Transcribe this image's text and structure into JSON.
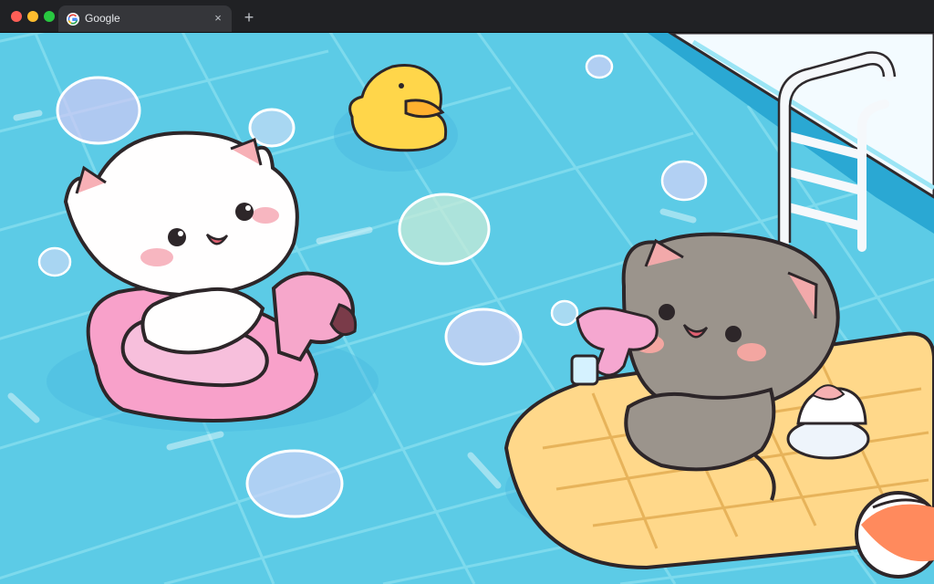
{
  "browser": {
    "tab": {
      "title": "Google",
      "favicon": "google-g-icon",
      "close_glyph": "×"
    },
    "new_tab_glyph": "+"
  },
  "wallpaper": {
    "scene": "pool",
    "colors": {
      "water": "#5ccbe6",
      "tile_line": "#8fe0f1",
      "flamingo": "#f29ac4",
      "duck": "#ffd84a",
      "mattress": "#ffd98a",
      "gray_cat": "#9b948c"
    }
  }
}
